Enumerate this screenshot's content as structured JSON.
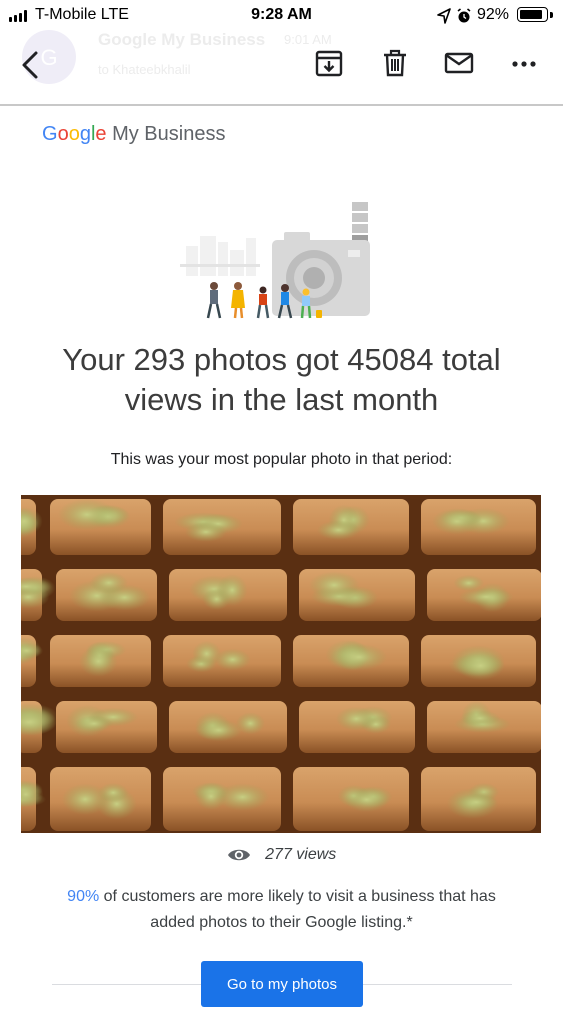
{
  "status_bar": {
    "carrier": "T-Mobile  LTE",
    "time": "9:28 AM",
    "battery_percent": "92%",
    "battery_level": 0.92,
    "signal_bars": 4
  },
  "mail_header": {
    "sender": "Google My Business",
    "time": "9:01 AM",
    "to": "to Khateebkhalil",
    "avatar_letter": "G",
    "icons": [
      "back-icon",
      "archive-icon",
      "trash-icon",
      "mail-icon",
      "more-icon"
    ]
  },
  "email": {
    "logo_google": [
      "G",
      "o",
      "o",
      "g",
      "l",
      "e"
    ],
    "logo_suffix": " My Business",
    "headline": "Your 293 photos got 45084 total views in the last month",
    "subhead": "This was your most popular photo in that period:",
    "photo_views": "277 views",
    "stat_percent": "90%",
    "stat_text": " of customers are more likely to visit a business that has added photos to their Google listing.*",
    "cta_label": "Go to my photos"
  },
  "colors": {
    "google_blue": "#4285F4",
    "google_red": "#EA4335",
    "google_yellow": "#FBBC05",
    "google_green": "#34A853",
    "cta_blue": "#1a73e8"
  }
}
